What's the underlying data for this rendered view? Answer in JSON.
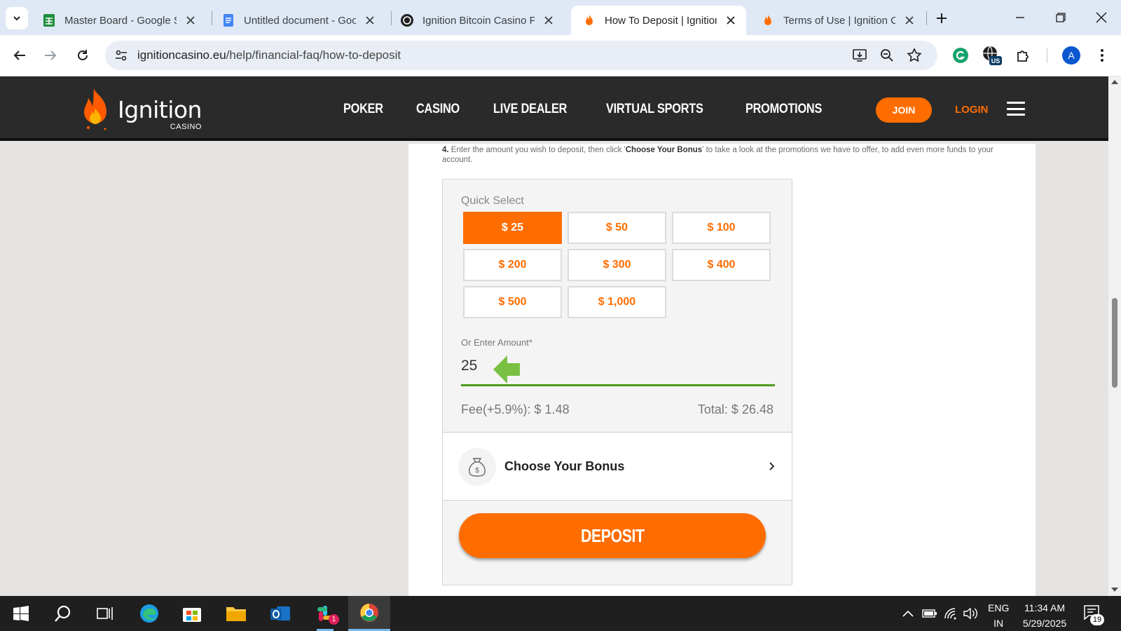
{
  "browser": {
    "tabs": [
      {
        "title": "Master Board - Google Sheets",
        "icon": "sheets-icon",
        "active": false
      },
      {
        "title": "Untitled document - Google Docs",
        "icon": "docs-icon",
        "active": false
      },
      {
        "title": "Ignition Bitcoin Casino Promotions",
        "icon": "chatgpt-icon",
        "active": false
      },
      {
        "title": "How To Deposit | Ignition Casino",
        "icon": "ignition-icon",
        "active": true
      },
      {
        "title": "Terms of Use | Ignition Casino",
        "icon": "ignition-icon",
        "active": false
      }
    ],
    "url_domain": "ignitioncasino.eu",
    "url_path": "/help/financial-faq/how-to-deposit",
    "extension_badge": "US",
    "profile_initial": "A"
  },
  "site": {
    "logo_word": "Ignition",
    "logo_sub": "CASINO",
    "nav": [
      "POKER",
      "CASINO",
      "LIVE DEALER",
      "VIRTUAL SPORTS",
      "PROMOTIONS"
    ],
    "join_label": "JOIN",
    "login_label": "LOGIN",
    "brand_color": "#ff6d00"
  },
  "content": {
    "step_number": "4.",
    "step_text_before": " Enter the amount you wish to deposit, then click '",
    "step_text_bold": "Choose Your Bonus",
    "step_text_after": "' to take a look at the promotions we have to offer, to add even more funds to your account.",
    "quick_select_label": "Quick Select",
    "amounts": [
      "$ 25",
      "$ 50",
      "$ 100",
      "$ 200",
      "$ 300",
      "$ 400",
      "$ 500",
      "$ 1,000"
    ],
    "selected_amount": "$ 25",
    "enter_amount_label": "Or Enter Amount*",
    "entered_amount": "25",
    "fee_text": "Fee(+5.9%): $ 1.48",
    "total_text": "Total: $ 26.48",
    "bonus_label": "Choose Your Bonus",
    "deposit_label": "DEPOSIT"
  },
  "taskbar": {
    "lang_line1": "ENG",
    "lang_line2": "IN",
    "time": "11:34 AM",
    "date": "5/29/2025",
    "notification_count": "19",
    "slack_badge": "1"
  }
}
